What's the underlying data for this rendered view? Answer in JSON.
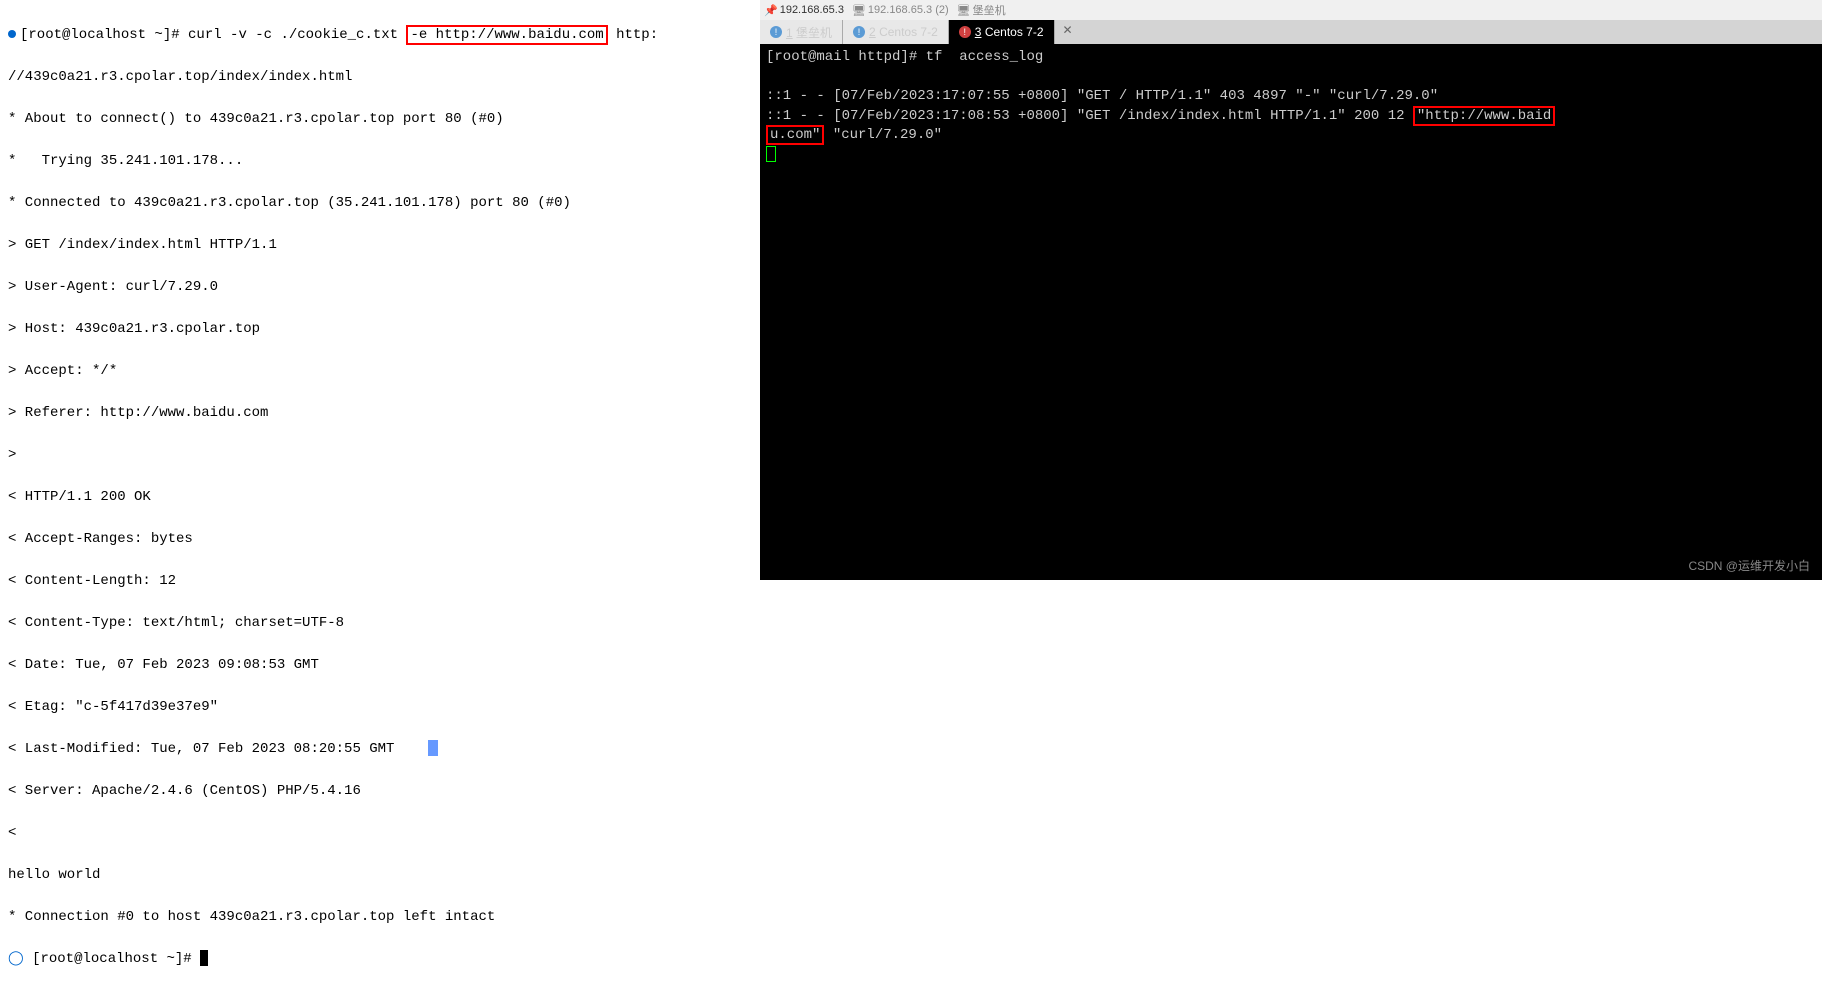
{
  "left_terminal": {
    "prompt": "[root@localhost ~]# ",
    "cmd_part1": "curl -v -c ./cookie_c.txt ",
    "cmd_highlight": "-e http://www.baidu.com",
    "cmd_part2": " http:",
    "lines": [
      "//439c0a21.r3.cpolar.top/index/index.html",
      "* About to connect() to 439c0a21.r3.cpolar.top port 80 (#0)",
      "*   Trying 35.241.101.178...",
      "* Connected to 439c0a21.r3.cpolar.top (35.241.101.178) port 80 (#0)",
      "> GET /index/index.html HTTP/1.1",
      "> User-Agent: curl/7.29.0",
      "> Host: 439c0a21.r3.cpolar.top",
      "> Accept: */*",
      "> Referer: http://www.baidu.com",
      ">",
      "< HTTP/1.1 200 OK",
      "< Accept-Ranges: bytes",
      "< Content-Length: 12",
      "< Content-Type: text/html; charset=UTF-8",
      "< Date: Tue, 07 Feb 2023 09:08:53 GMT",
      "< Etag: \"c-5f417d39e37e9\""
    ],
    "line_with_cursor": "< Last-Modified: Tue, 07 Feb 2023 08:20:55 GMT    ",
    "lines_after": [
      "< Server: Apache/2.4.6 (CentOS) PHP/5.4.16",
      "<",
      "hello world",
      "* Connection #0 to host 439c0a21.r3.cpolar.top left intact"
    ],
    "prompt2": "[root@localhost ~]# "
  },
  "right_terminal": {
    "title_items": [
      "192.168.65.3",
      "192.168.65.3 (2)",
      "堡垒机"
    ],
    "tabs": [
      {
        "icon": "blue",
        "num": "1",
        "label": "堡垒机"
      },
      {
        "icon": "blue",
        "num": "2",
        "label": "Centos 7-2"
      },
      {
        "icon": "red",
        "num": "3",
        "label": "Centos 7-2"
      }
    ],
    "prompt": "[root@mail httpd]# ",
    "cmd": "tf  access_log",
    "blank": " ",
    "log1": "::1 - - [07/Feb/2023:17:07:55 +0800] \"GET / HTTP/1.1\" 403 4897 \"-\" \"curl/7.29.0\"",
    "log2_part1": "::1 - - [07/Feb/2023:17:08:53 +0800] \"GET /index/index.html HTTP/1.1\" 200 12 ",
    "log2_highlight1": "\"http://www.baid",
    "log2_highlight2": "u.com\"",
    "log2_part2": " \"curl/7.29.0\""
  },
  "watermark": "CSDN @运维开发小白"
}
